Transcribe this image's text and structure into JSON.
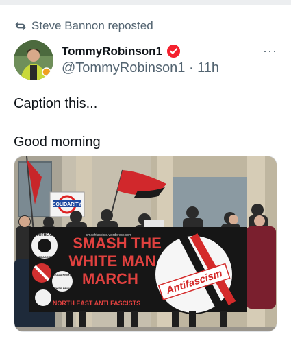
{
  "repost": {
    "label": "Steve Bannon reposted",
    "icon": "repost-icon"
  },
  "author": {
    "display_name": "TommyRobinson1",
    "handle": "@TommyRobinson1",
    "separator": "·",
    "time": "11h",
    "verified": true,
    "verified_color": "#f4212e"
  },
  "menu": {
    "label": "···"
  },
  "tweet": {
    "line1": "Caption this...",
    "line2": "Good morning"
  },
  "media": {
    "banner_line1": "SMASH THE",
    "banner_line2": "WHITE MAN",
    "banner_line3": "MARCH",
    "banner_footer": "NORTH EAST ANTI FASCISTS",
    "banner_url": "smashfascists.wordpress.com",
    "placard": "SOLIDARITY",
    "circle_logo_text": "Antifascism",
    "circle_logo_sub": "NORTHEAST",
    "badge_top": "NORTHEAST",
    "badge_side": "ANTIFASCISTS",
    "badge_good": "GOOD NIGHT",
    "badge_pride": "WHITE PRIDE"
  }
}
